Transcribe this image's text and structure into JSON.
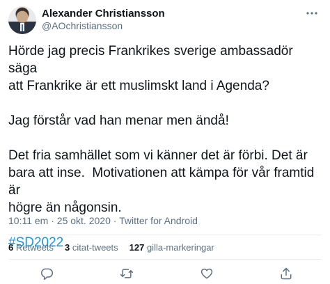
{
  "author": {
    "display_name": "Alexander Christiansson",
    "handle": "@AOchristiansson"
  },
  "tweet": {
    "paragraphs": [
      "Hörde jag precis Frankrikes sverige ambassadör säga\natt Frankrike är ett muslimskt land i Agenda?",
      "Jag förstår vad han menar men ändå!",
      "Det fria samhället som vi känner det är förbi. Det är\nbara att inse.  Motivationen att kämpa för vår framtid är\nhögre än någonsin."
    ],
    "hashtag": "#SD2022"
  },
  "meta": {
    "time": "10:11 em",
    "separator": " · ",
    "date": "25 okt. 2020",
    "separator2": " · ",
    "source": "Twitter for Android"
  },
  "stats": {
    "retweets_count": "6",
    "retweets_label": " Retweets",
    "quotes_count": "3",
    "quotes_label": " citat-tweets",
    "likes_count": "127",
    "likes_label": " gilla-markeringar"
  },
  "colors": {
    "accent": "#1b95e0",
    "secondary_text": "#5b7083",
    "primary_text": "#0f1419",
    "divider": "#e6ecf0"
  },
  "icons": {
    "more": "more-icon",
    "reply": "reply-icon",
    "retweet": "retweet-icon",
    "like": "like-icon",
    "share": "share-icon"
  }
}
